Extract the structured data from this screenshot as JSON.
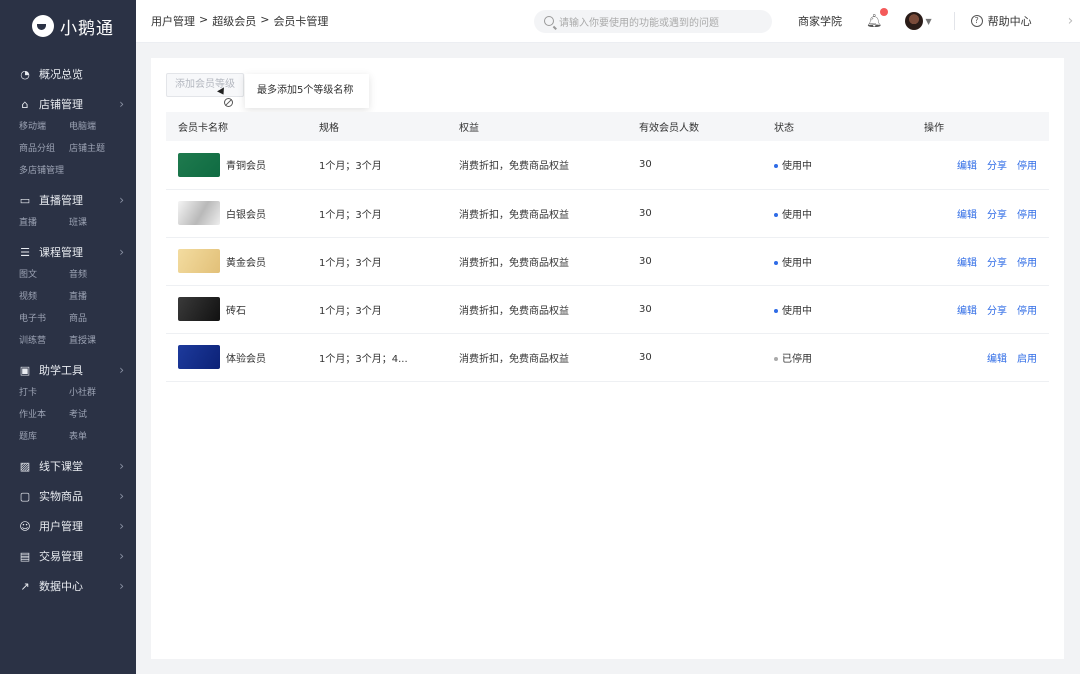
{
  "app": {
    "logo_text": "小鹅通"
  },
  "sidebar": {
    "groups": [
      {
        "label": "概况总览",
        "icon": "dashboard-icon",
        "has_chevron": false,
        "subs": []
      },
      {
        "label": "店铺管理",
        "icon": "store-icon",
        "has_chevron": true,
        "subs": [
          "移动端",
          "电脑端",
          "商品分组",
          "店铺主题",
          "多店铺管理"
        ]
      },
      {
        "label": "直播管理",
        "icon": "live-icon",
        "has_chevron": true,
        "subs": [
          "直播",
          "班课"
        ]
      },
      {
        "label": "课程管理",
        "icon": "course-icon",
        "has_chevron": true,
        "subs": [
          "图文",
          "音频",
          "视频",
          "直播",
          "电子书",
          "商品",
          "训练营",
          "直授课"
        ]
      },
      {
        "label": "助学工具",
        "icon": "toolbox-icon",
        "has_chevron": true,
        "subs": [
          "打卡",
          "小社群",
          "作业本",
          "考试",
          "题库",
          "表单"
        ]
      },
      {
        "label": "线下课堂",
        "icon": "classroom-icon",
        "has_chevron": true,
        "subs": []
      },
      {
        "label": "实物商品",
        "icon": "product-icon",
        "has_chevron": true,
        "subs": []
      },
      {
        "label": "用户管理",
        "icon": "user-icon",
        "has_chevron": true,
        "subs": []
      },
      {
        "label": "交易管理",
        "icon": "trade-icon",
        "has_chevron": true,
        "subs": []
      },
      {
        "label": "数据中心",
        "icon": "chart-icon",
        "has_chevron": true,
        "subs": []
      }
    ]
  },
  "header": {
    "breadcrumb": [
      "用户管理",
      ">",
      "超级会员",
      ">",
      "会员卡管理"
    ],
    "search_placeholder": "请输入你要使用的功能或遇到的问题",
    "academy": "商家学院",
    "help": "帮助中心"
  },
  "toolbar": {
    "add_level": "添加会员等级",
    "tooltip": "最多添加5个等级名称"
  },
  "table": {
    "headers": [
      "会员卡名称",
      "规格",
      "权益",
      "有效会员人数",
      "状态",
      "操作"
    ],
    "rows": [
      {
        "name": "青铜会员",
        "swatch": "linear-gradient(135deg,#1f7a4e,#0f6b42)",
        "spec": "1个月；3个月",
        "benefit": "消费折扣，免费商品权益",
        "count": "30",
        "status": "使用中",
        "status_color": "#2e6be6",
        "disabled": false,
        "ops": [
          "编辑",
          "分享",
          "停用"
        ]
      },
      {
        "name": "白银会员",
        "swatch": "linear-gradient(120deg,#f4f4f4,#b9b9b9 55%,#eeeeee)",
        "spec": "1个月；3个月",
        "benefit": "消费折扣，免费商品权益",
        "count": "30",
        "status": "使用中",
        "status_color": "#2e6be6",
        "disabled": false,
        "ops": [
          "编辑",
          "分享",
          "停用"
        ]
      },
      {
        "name": "黄金会员",
        "swatch": "linear-gradient(120deg,#f3dca0,#e2c078)",
        "spec": "1个月；3个月",
        "benefit": "消费折扣，免费商品权益",
        "count": "30",
        "status": "使用中",
        "status_color": "#2e6be6",
        "disabled": false,
        "ops": [
          "编辑",
          "分享",
          "停用"
        ]
      },
      {
        "name": "砖石",
        "swatch": "linear-gradient(120deg,#3a3a3a,#111111)",
        "spec": "1个月；3个月",
        "benefit": "消费折扣，免费商品权益",
        "count": "30",
        "status": "使用中",
        "status_color": "#2e6be6",
        "disabled": false,
        "ops": [
          "编辑",
          "分享",
          "停用"
        ]
      },
      {
        "name": "体验会员",
        "swatch": "linear-gradient(120deg,#1d3a9c,#0c2277)",
        "spec": "1个月；3个月；4...",
        "benefit": "消费折扣，免费商品权益",
        "count": "30",
        "status": "已停用",
        "status_color": "#aaaaaa",
        "disabled": true,
        "ops": [
          "编辑",
          "启用"
        ]
      }
    ]
  },
  "colors": {
    "sidebar_bg": "#2b3245",
    "accent": "#2e6be6",
    "badge": "#f45a5a"
  }
}
